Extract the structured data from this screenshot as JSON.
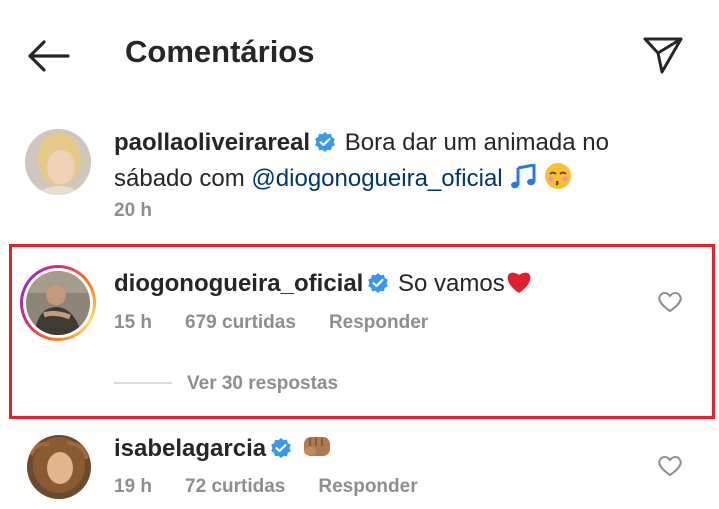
{
  "header": {
    "title": "Comentários",
    "back_icon": "arrow-left-icon",
    "share_icon": "paper-plane-icon"
  },
  "comments": [
    {
      "username": "paollaoliveirareal",
      "verified": true,
      "text_line1": "Bora dar um animada no",
      "text_line2_prefix": "sábado com ",
      "mention": "@diogonogueira_oficial",
      "emojis": [
        "music-note-icon",
        "kissing-face-icon"
      ],
      "time": "20 h"
    },
    {
      "username": "diogonogueira_oficial",
      "verified": true,
      "text": "So vamos",
      "emoji": "red-heart-icon",
      "time": "15 h",
      "likes": "679 curtidas",
      "reply_label": "Responder",
      "view_replies": "Ver 30 respostas",
      "highlighted": true
    },
    {
      "username": "isabelagarcia",
      "verified": true,
      "emoji": "fist-bump-icon",
      "time": "19 h",
      "likes": "72 curtidas",
      "reply_label": "Responder"
    }
  ],
  "colors": {
    "verified": "#3897f0",
    "mention": "#00376b",
    "highlight_border": "#e3202b",
    "meta": "#8e8e8e"
  }
}
